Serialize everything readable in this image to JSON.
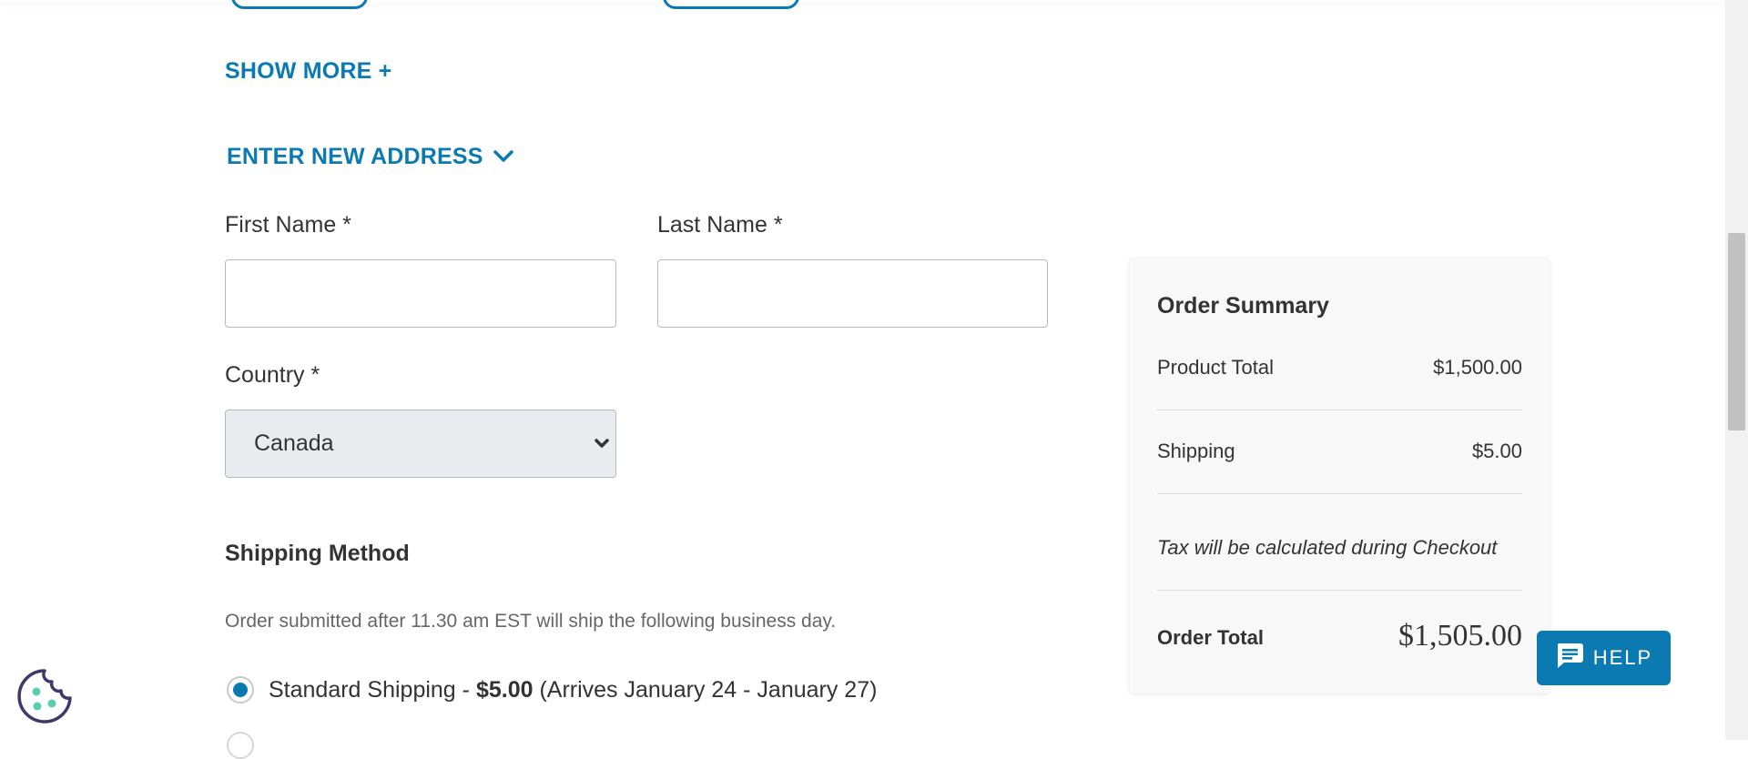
{
  "links": {
    "show_more": "SHOW MORE +",
    "enter_new_address": "ENTER NEW ADDRESS"
  },
  "form": {
    "first_name_label": "First Name *",
    "first_name_value": "",
    "last_name_label": "Last Name *",
    "last_name_value": "",
    "country_label": "Country *",
    "country_value": "Canada"
  },
  "shipping": {
    "heading": "Shipping Method",
    "note": "Order submitted after 11.30 am EST will ship the following business day.",
    "options": [
      {
        "name": "Standard Shipping - ",
        "price": "$5.00",
        "arrival": " (Arrives January 24 - January 27)",
        "selected": true
      }
    ]
  },
  "summary": {
    "title": "Order Summary",
    "product_total_label": "Product Total",
    "product_total_value": "$1,500.00",
    "shipping_label": "Shipping",
    "shipping_value": "$5.00",
    "tax_note": "Tax will be calculated during Checkout",
    "order_total_label": "Order Total",
    "order_total_value": "$1,505.00"
  },
  "help": {
    "label": "HELP",
    "icon": "chat-icon"
  },
  "cookie": {
    "icon": "cookie-icon"
  },
  "colors": {
    "accent": "#0b7ab3",
    "text": "#333333",
    "summary_bg": "#f8f8f8",
    "select_bg": "#e9ecef"
  }
}
